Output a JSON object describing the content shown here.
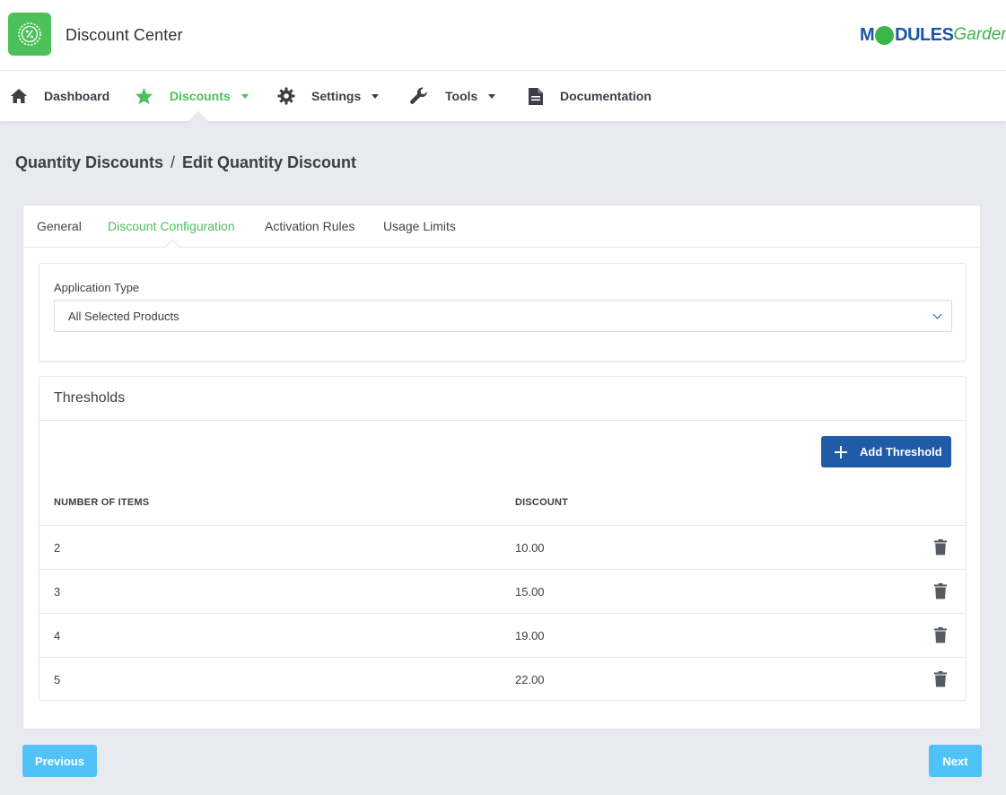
{
  "header": {
    "app_title": "Discount Center",
    "app_icon": "discount-badge-icon",
    "brand_part1": "M",
    "brand_part2": "DULES",
    "brand_part3": "Garden",
    "accent_color": "#4cc15a",
    "primary_color": "#1f5ba6"
  },
  "nav": {
    "items": [
      {
        "label": "Dashboard",
        "icon": "home-icon"
      },
      {
        "label": "Discounts",
        "icon": "star-icon",
        "active": true
      },
      {
        "label": "Settings",
        "icon": "gear-icon"
      },
      {
        "label": "Tools",
        "icon": "wrench-icon"
      },
      {
        "label": "Documentation",
        "icon": "document-icon"
      }
    ]
  },
  "breadcrumb": {
    "parent": "Quantity Discounts",
    "separator": "/",
    "current": "Edit Quantity Discount"
  },
  "tabs": [
    {
      "label": "General"
    },
    {
      "label": "Discount Configuration",
      "active": true
    },
    {
      "label": "Activation Rules"
    },
    {
      "label": "Usage Limits"
    }
  ],
  "application_type": {
    "label": "Application Type",
    "selected": "All Selected Products"
  },
  "thresholds": {
    "title": "Thresholds",
    "add_button": "Add Threshold",
    "col_items": "NUMBER OF ITEMS",
    "col_discount": "DISCOUNT",
    "rows": [
      {
        "items": "2",
        "discount": "10.00"
      },
      {
        "items": "3",
        "discount": "15.00"
      },
      {
        "items": "4",
        "discount": "19.00"
      },
      {
        "items": "5",
        "discount": "22.00"
      }
    ]
  },
  "footer": {
    "previous": "Previous",
    "next": "Next",
    "button_color": "#4fc3f7"
  }
}
